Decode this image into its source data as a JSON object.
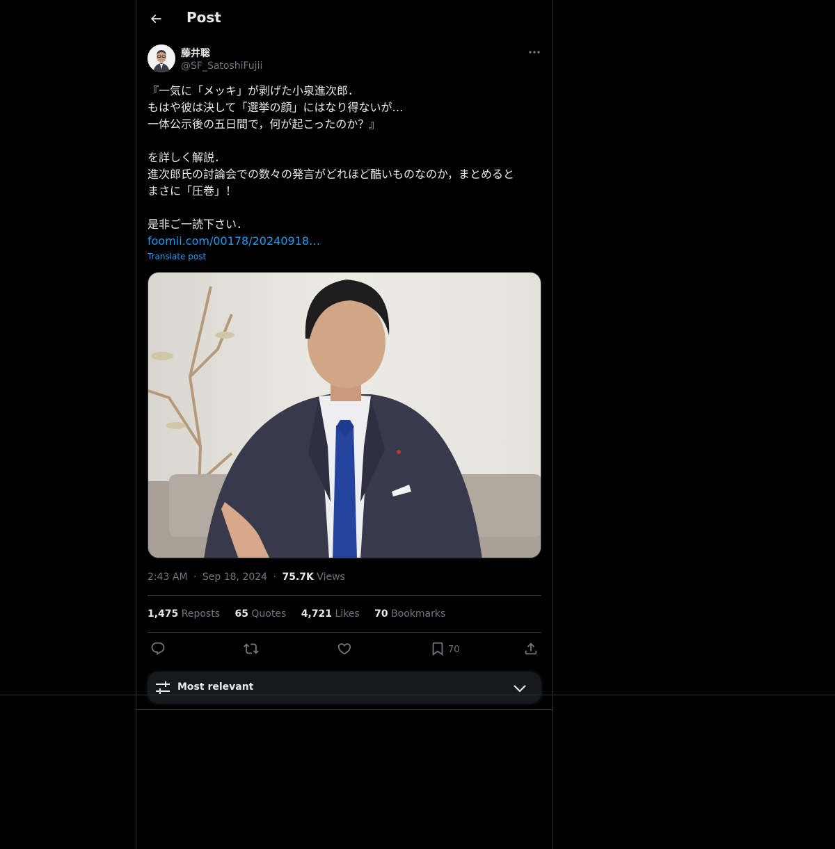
{
  "header": {
    "title": "Post"
  },
  "author": {
    "name": "藤井聡",
    "handle": "@SF_SatoshiFujii"
  },
  "post": {
    "lines": [
      "『一気に「メッキ」が剥げた小泉進次郎．",
      "もはや彼は決して「選挙の顔」にはなり得ないが…",
      "一体公示後の五日間で，何が起こったのか？』",
      "",
      "を詳しく解説．",
      "進次郎氏の討論会での数々の発言がどれほど酷いものなのか，まとめると",
      "まさに「圧巻」！",
      "",
      "是非ご一読下さい．"
    ],
    "link": "foomii.com/00178/20240918…",
    "translate_label": "Translate post"
  },
  "meta": {
    "time": "2:43 AM",
    "sep1": "·",
    "date": "Sep 18, 2024",
    "sep2": "·",
    "views_count": "75.7K",
    "views_label": "Views"
  },
  "stats": {
    "reposts_count": "1,475",
    "reposts_label": "Reposts",
    "quotes_count": "65",
    "quotes_label": "Quotes",
    "likes_count": "4,721",
    "likes_label": "Likes",
    "bookmarks_count": "70",
    "bookmarks_label": "Bookmarks"
  },
  "actions": {
    "bookmark_count": "70",
    "icons": [
      "reply-icon",
      "repost-icon",
      "like-icon",
      "bookmark-icon",
      "share-icon"
    ]
  },
  "sort": {
    "label": "Most relevant"
  },
  "colors": {
    "background": "#000000",
    "link": "#1d9bf0",
    "muted": "#71767b",
    "text": "#e7e9ea",
    "border": "#2f3336"
  }
}
